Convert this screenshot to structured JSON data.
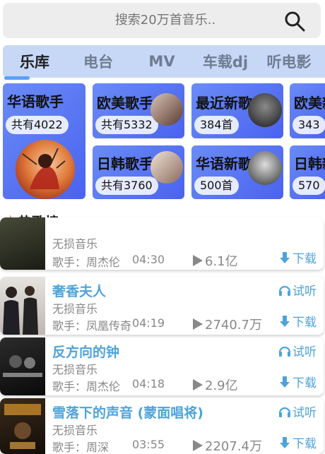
{
  "search": {
    "placeholder": "搜索20万首音乐.."
  },
  "tabs": [
    "乐库",
    "电台",
    "MV",
    "车载dj",
    "听电影"
  ],
  "categories": [
    {
      "title": "华语歌手",
      "count": "共有4022"
    },
    {
      "title": "欧美歌手",
      "count": "共有5332"
    },
    {
      "title": "日韩歌手",
      "count": "共有3760"
    },
    {
      "title": "最近新歌",
      "count": "384首"
    },
    {
      "title": "华语新歌",
      "count": "500首"
    },
    {
      "title": "欧美新",
      "count": "343"
    },
    {
      "title": "日韩新",
      "count": "570"
    }
  ],
  "hot": {
    "title": "热歌榜："
  },
  "songs": [
    {
      "name": "",
      "quality": "无损音乐",
      "singer": "歌手：周杰伦",
      "duration": "04:30",
      "plays": "6.1亿",
      "listen": "",
      "download": "下载"
    },
    {
      "name": "奢香夫人",
      "quality": "无损音乐",
      "singer": "歌手：凤凰传奇",
      "duration": "04:19",
      "plays": "2740.7万",
      "listen": "试听",
      "download": "下载"
    },
    {
      "name": "反方向的钟",
      "quality": "无损音乐",
      "singer": "歌手：周杰伦",
      "duration": "04:18",
      "plays": "2.9亿",
      "listen": "试听",
      "download": "下载"
    },
    {
      "name": "雪落下的声音 (蒙面唱将)",
      "quality": "无损音乐",
      "singer": "歌手：周深",
      "duration": "03:55",
      "plays": "2207.4万",
      "listen": "试听",
      "download": "下载"
    }
  ],
  "colors": {
    "accent": "#4ea3d9",
    "tabbar": "#c7d8f7",
    "card": "#5573f3",
    "indicator": "#5aa1f7"
  }
}
